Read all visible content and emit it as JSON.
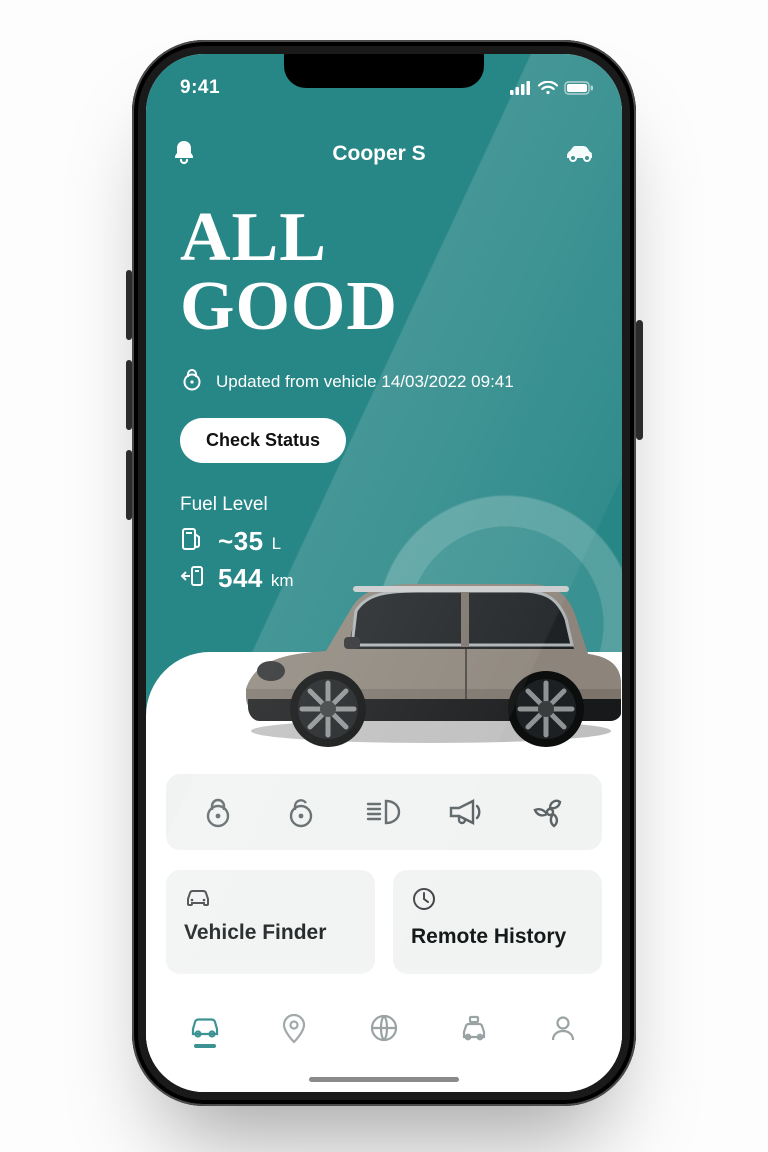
{
  "status_bar": {
    "time": "9:41"
  },
  "header": {
    "title": "Cooper S"
  },
  "hero": {
    "title_line1": "ALL",
    "title_line2": "GOOD",
    "updated_text": "Updated from vehicle 14/03/2022 09:41",
    "check_status_label": "Check Status"
  },
  "fuel": {
    "label": "Fuel Level",
    "amount_prefix": "~",
    "amount_value": "35",
    "amount_unit": "L",
    "range_value": "544",
    "range_unit": "km"
  },
  "quick_actions": [
    {
      "id": "lock"
    },
    {
      "id": "unlock"
    },
    {
      "id": "lights"
    },
    {
      "id": "horn"
    },
    {
      "id": "ventilate"
    }
  ],
  "cards": [
    {
      "id": "vehicle-finder",
      "title": "Vehicle Finder",
      "icon": "car"
    },
    {
      "id": "remote-history",
      "title": "Remote History",
      "icon": "clock"
    }
  ],
  "nav": {
    "active": 0,
    "items": [
      {
        "id": "vehicle"
      },
      {
        "id": "map-pin"
      },
      {
        "id": "globe"
      },
      {
        "id": "service"
      },
      {
        "id": "profile"
      }
    ]
  },
  "colors": {
    "brand": "#278686"
  }
}
